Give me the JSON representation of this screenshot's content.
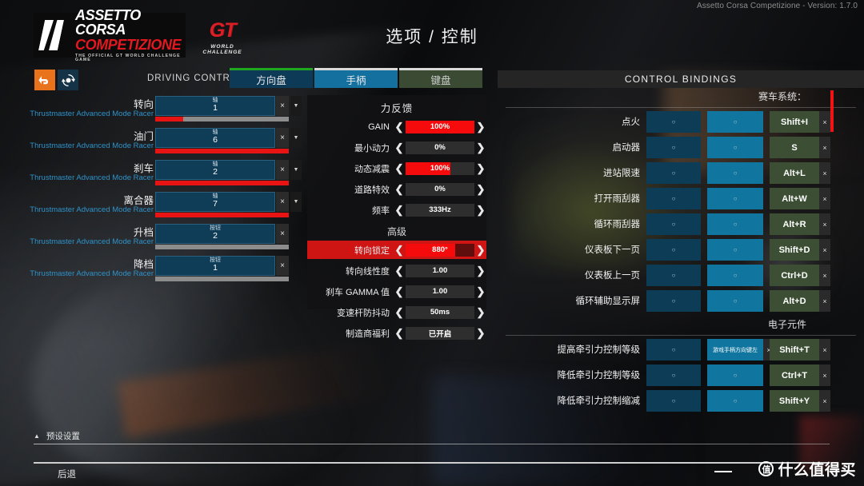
{
  "window": {
    "version_text": "Assetto Corsa Competizione - Version: 1.7.0"
  },
  "branding": {
    "logo_line1": "ASSETTO CORSA",
    "logo_line2": "COMPETIZIONE",
    "logo_tagline": "THE OFFICIAL GT WORLD CHALLENGE GAME",
    "gt_mark": "GT",
    "gt_sub": "WORLD CHALLENGE"
  },
  "header": {
    "title": "选项 / 控制"
  },
  "toolbar": {
    "undo_icon": "undo-arrow-icon",
    "reset_icon": "refresh-cycle-icon",
    "driving_control_label": "DRIVING CONTROL",
    "tabs": [
      {
        "label": "方向盘",
        "state": "selected",
        "accent": "#1fa81f"
      },
      {
        "label": "手柄",
        "state": "active",
        "accent": "#d9d9d9"
      },
      {
        "label": "键盘",
        "state": "inactive",
        "accent": "#d9d9d9"
      }
    ]
  },
  "driving_bindings": [
    {
      "name": "转向",
      "device": "Thrustmaster Advanced Mode Racer",
      "type": "轴",
      "value": "1",
      "fill_pct": 21,
      "track_color": "#8c8c8c",
      "has_dropdown": true
    },
    {
      "name": "油门",
      "device": "Thrustmaster Advanced Mode Racer",
      "type": "轴",
      "value": "6",
      "fill_pct": 100,
      "track_color": "#8c8c8c",
      "has_dropdown": true
    },
    {
      "name": "刹车",
      "device": "Thrustmaster Advanced Mode Racer",
      "type": "轴",
      "value": "2",
      "fill_pct": 100,
      "track_color": "#8c8c8c",
      "has_dropdown": true
    },
    {
      "name": "离合器",
      "device": "Thrustmaster Advanced Mode Racer",
      "type": "轴",
      "value": "7",
      "fill_pct": 100,
      "track_color": "#8c8c8c",
      "has_dropdown": true
    },
    {
      "name": "升档",
      "device": "Thrustmaster Advanced Mode Racer",
      "type": "按钮",
      "value": "2",
      "fill_pct": 0,
      "track_color": "#8c8c8c",
      "has_dropdown": false
    },
    {
      "name": "降档",
      "device": "Thrustmaster Advanced Mode Racer",
      "type": "按钮",
      "value": "1",
      "fill_pct": 0,
      "track_color": "#8c8c8c",
      "has_dropdown": false
    }
  ],
  "force_feedback": {
    "title": "力反馈",
    "advanced_title": "高级",
    "rows": [
      {
        "label": "GAIN",
        "value": "100%",
        "fill_pct": 100,
        "highlight": false
      },
      {
        "label": "最小动力",
        "value": "0%",
        "fill_pct": 0,
        "highlight": false
      },
      {
        "label": "动态减震",
        "value": "100%",
        "fill_pct": 65,
        "highlight": false
      },
      {
        "label": "道路特效",
        "value": "0%",
        "fill_pct": 0,
        "highlight": false
      },
      {
        "label": "频率",
        "value": "333Hz",
        "fill_pct": 0,
        "highlight": false
      }
    ],
    "advanced_rows": [
      {
        "label": "转向锁定",
        "value": "880°",
        "fill_pct": 72,
        "highlight": true
      },
      {
        "label": "转向线性度",
        "value": "1.00",
        "fill_pct": 0,
        "highlight": false
      },
      {
        "label": "刹车 GAMMA 值",
        "value": "1.00",
        "fill_pct": 0,
        "highlight": false
      },
      {
        "label": "变速杆防抖动",
        "value": "50ms",
        "fill_pct": 0,
        "highlight": false
      },
      {
        "label": "制造商福利",
        "value": "已开启",
        "fill_pct": 0,
        "highlight": false
      }
    ],
    "arrow_left": "chevron-left-icon",
    "arrow_right": "chevron-right-icon"
  },
  "control_bindings": {
    "header": "CONTROL BINDINGS",
    "sections": [
      {
        "title": "赛车系统：",
        "rows": [
          {
            "label": "点火",
            "wheel": "○",
            "pad": "○",
            "pad_filled": false,
            "key": "Shift+I"
          },
          {
            "label": "启动器",
            "wheel": "○",
            "pad": "○",
            "pad_filled": false,
            "key": "S"
          },
          {
            "label": "进站限速",
            "wheel": "○",
            "pad": "○",
            "pad_filled": false,
            "key": "Alt+L"
          },
          {
            "label": "打开雨刮器",
            "wheel": "○",
            "pad": "○",
            "pad_filled": false,
            "key": "Alt+W"
          },
          {
            "label": "循环雨刮器",
            "wheel": "○",
            "pad": "○",
            "pad_filled": false,
            "key": "Alt+R"
          },
          {
            "label": "仪表板下一页",
            "wheel": "○",
            "pad": "○",
            "pad_filled": false,
            "key": "Shift+D"
          },
          {
            "label": "仪表板上一页",
            "wheel": "○",
            "pad": "○",
            "pad_filled": false,
            "key": "Ctrl+D"
          },
          {
            "label": "循环辅助显示屏",
            "wheel": "○",
            "pad": "○",
            "pad_filled": false,
            "key": "Alt+D"
          }
        ]
      },
      {
        "title": "电子元件",
        "rows": [
          {
            "label": "提高牵引力控制等级",
            "wheel": "○",
            "pad": "游戏手柄方向键左",
            "pad_filled": true,
            "key": "Shift+T"
          },
          {
            "label": "降低牵引力控制等级",
            "wheel": "○",
            "pad": "○",
            "pad_filled": false,
            "key": "Ctrl+T"
          },
          {
            "label": "降低牵引力控制缩减",
            "wheel": "○",
            "pad": "○",
            "pad_filled": false,
            "key": "Shift+Y"
          }
        ]
      }
    ],
    "clear_symbol": "×"
  },
  "footer": {
    "preset_label": "预设设置",
    "preset_arrow": "triangle-up-icon",
    "back_label": "后退"
  },
  "watermark": {
    "badge": "值",
    "text": "什么值得买"
  },
  "colors": {
    "accent_red": "#e81414",
    "accent_orange": "#e8731c",
    "wheel_blue": "#0d3c56",
    "pad_blue": "#11769f",
    "key_green": "#3c4f35",
    "device_blue": "#2f92c9"
  }
}
